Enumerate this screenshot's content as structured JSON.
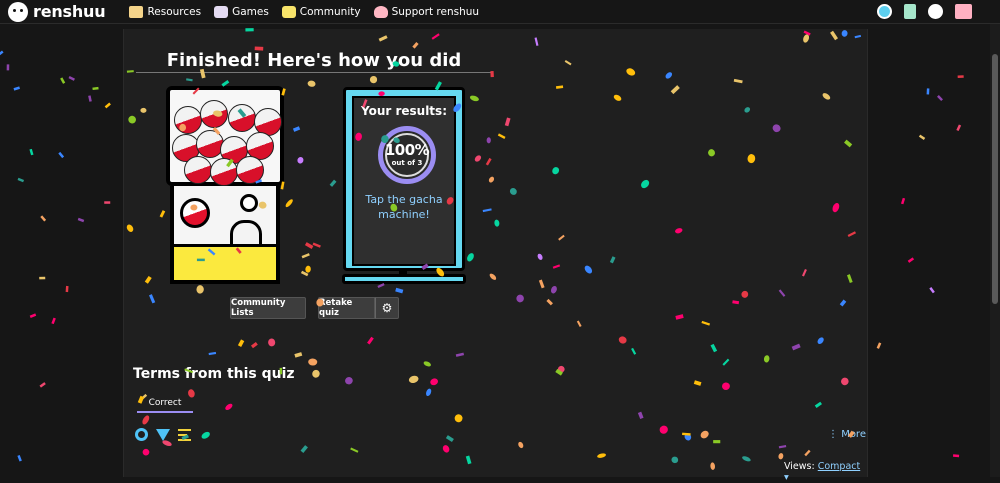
{
  "app": {
    "brand": "renshuu"
  },
  "nav": {
    "items": [
      {
        "label": "Resources",
        "icon": "book-icon"
      },
      {
        "label": "Games",
        "icon": "dice-icon"
      },
      {
        "label": "Community",
        "icon": "chat-icon"
      },
      {
        "label": "Support renshuu",
        "icon": "heart-icon"
      }
    ],
    "right_icons": [
      "help-icon",
      "flashcards-icon",
      "speech-bubble-icon",
      "mail-icon"
    ]
  },
  "results": {
    "title": "Finished! Here's how you did",
    "your_results_label": "Your results:",
    "percent": "100%",
    "out_of": "out of 3",
    "tap_message": "Tap the gacha machine!"
  },
  "actions": {
    "community_lists": "Community Lists",
    "retake_quiz": "Retake quiz",
    "settings_icon": "gear-icon"
  },
  "terms": {
    "heading": "Terms from this quiz",
    "tab_correct": "Correct",
    "tools": [
      "search-icon",
      "filter-icon",
      "sort-icon"
    ],
    "more_label": "More",
    "views_label": "Views:",
    "views_value": "Compact"
  },
  "colors": {
    "background": "#161616",
    "panel": "#1f1f1f",
    "accent_purple": "#9b8df2",
    "link_blue": "#8fd0ff",
    "monitor_cyan": "#65d8f0",
    "gacha_red": "#d8102a",
    "gacha_yellow": "#fbe93e"
  }
}
